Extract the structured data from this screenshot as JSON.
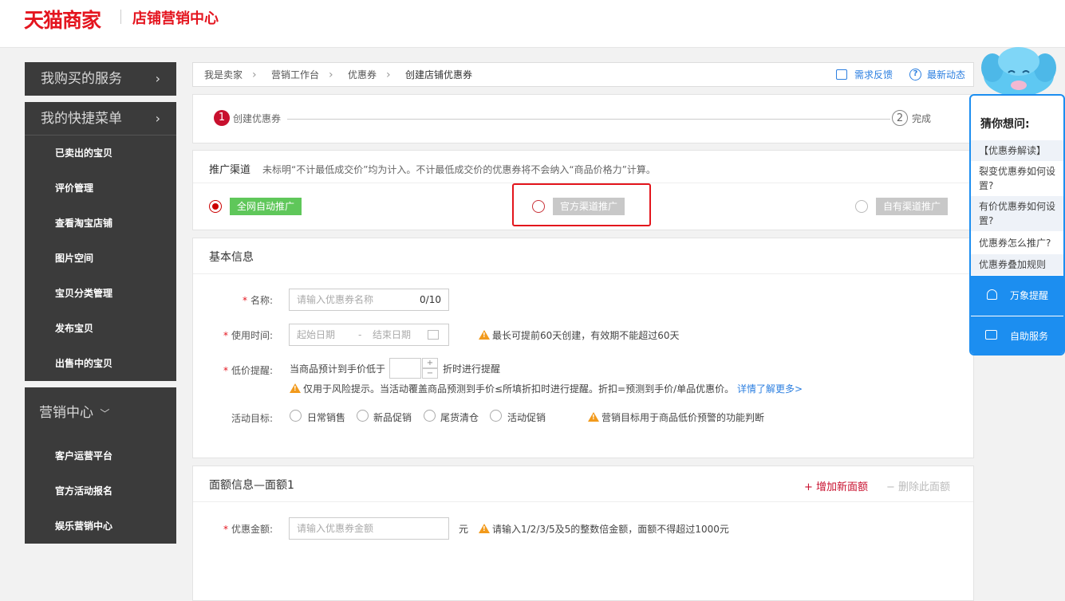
{
  "header": {
    "logo": "天猫商家",
    "subtitle": "店铺营销中心"
  },
  "sidebar": {
    "blocks": [
      {
        "title": "我购买的服务",
        "chevron": "›",
        "items": []
      },
      {
        "title": "我的快捷菜单",
        "chevron": "›",
        "items": [
          "已卖出的宝贝",
          "评价管理",
          "查看淘宝店铺",
          "图片空间",
          "宝贝分类管理",
          "发布宝贝",
          "出售中的宝贝"
        ]
      },
      {
        "title": "营销中心",
        "chevron": "﹀",
        "items": [
          "客户运营平台",
          "官方活动报名",
          "娱乐营销中心"
        ]
      }
    ]
  },
  "breadcrumb": {
    "items": [
      "我是卖家",
      "营销工作台",
      "优惠券",
      "创建店铺优惠券"
    ],
    "sep": "›",
    "feedback": "需求反馈",
    "news": "最新动态",
    "news_icon": "?"
  },
  "steps": [
    {
      "num": "1",
      "label": "创建优惠券"
    },
    {
      "num": "2",
      "label": "完成"
    }
  ],
  "channel": {
    "title": "推广渠道",
    "note": "未标明“不计最低成交价”均为计入。不计最低成交价的优惠券将不会纳入“商品价格力”计算。",
    "options": [
      "全网自动推广",
      "官方渠道推广",
      "自有渠道推广"
    ],
    "selected": 0,
    "colors": {
      "active": "#5fc75a",
      "disabled": "#c8c8c8"
    }
  },
  "basic": {
    "title": "基本信息",
    "name_label": "名称:",
    "name_placeholder": "请输入优惠券名称",
    "name_count": "0/10",
    "time_label": "使用时间:",
    "start_placeholder": "起始日期",
    "range_sep": "-",
    "end_placeholder": "结束日期",
    "time_tip": "最长可提前60天创建，有效期不能超过60天",
    "price_label": "低价提醒:",
    "price_prefix": "当商品预计到手价低于",
    "price_suffix": "折时进行提醒",
    "price_tip": "仅用于风险提示。当活动覆盖商品预测到手价≤所填折扣时进行提醒。折扣=预测到手价/单品优惠价。",
    "price_link": "详情了解更多>",
    "goal_label": "活动目标:",
    "goals": [
      "日常销售",
      "新品促销",
      "尾货清仓",
      "活动促销"
    ],
    "goal_tip": "营销目标用于商品低价预警的功能判断",
    "stepper_plus": "+",
    "stepper_minus": "−"
  },
  "face": {
    "title": "面额信息—面额1",
    "add": "+ 增加新面额",
    "remove": "− 删除此面额",
    "amount_label": "优惠金额:",
    "amount_placeholder": "请输入优惠券金额",
    "unit": "元",
    "amount_tip": "请输入1/2/3/5及5的整数倍金额，面额不得超过1000元"
  },
  "helper": {
    "title": "猜你想问:",
    "questions": [
      "【优惠券解读】",
      "裂变优惠券如何设置?",
      "有价优惠券如何设置?",
      "优惠券怎么推广?",
      "优惠券叠加规则"
    ],
    "buttons": [
      "万象提醒",
      "自助服务"
    ]
  },
  "colors": {
    "brand": "#e4151f",
    "link": "#2c7fe0",
    "helper": "#1c8ef0"
  }
}
